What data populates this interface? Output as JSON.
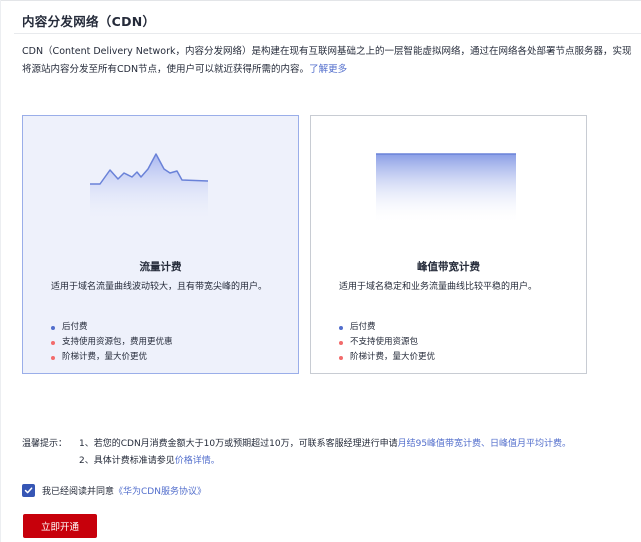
{
  "page": {
    "title": "内容分发网络（CDN）",
    "intro_text": "CDN（Content Delivery Network，内容分发网络）是构建在现有互联网基础之上的一层智能虚拟网络，通过在网络各处部署节点服务器，实现将源站内容分发至所有CDN节点，使用户可以就近获得所需的内容。",
    "intro_link": "了解更多"
  },
  "billing_options": [
    {
      "title": "流量计费",
      "description": "适用于域名流量曲线波动较大，且有带宽尖峰的用户。",
      "features": [
        {
          "text": "后付费",
          "dot": "blue"
        },
        {
          "text": "支持使用资源包，费用更优惠",
          "dot": "red"
        },
        {
          "text": "阶梯计费，量大价更优",
          "dot": "red"
        }
      ],
      "selected": true
    },
    {
      "title": "峰值带宽计费",
      "description": "适用于域名稳定和业务流量曲线比较平稳的用户。",
      "features": [
        {
          "text": "后付费",
          "dot": "blue"
        },
        {
          "text": "不支持使用资源包",
          "dot": "red"
        },
        {
          "text": "阶梯计费，量大价更优",
          "dot": "red"
        }
      ],
      "selected": false
    }
  ],
  "tips": {
    "label": "温馨提示：",
    "line1_prefix": "1、若您的CDN月消费金额大于10万或预期超过10万，可联系客服经理进行申请",
    "line1_link": "月结95峰值带宽计费、日峰值月平均计费。",
    "line2_prefix": "2、具体计费标准请参见",
    "line2_link": "价格详情。"
  },
  "agreement": {
    "checked": true,
    "label_prefix": "我已经阅读并同意",
    "link": "《华为CDN服务协议》"
  },
  "action": {
    "button_label": "立即开通"
  },
  "colors": {
    "accent": "#526ecc",
    "brand_red": "#c7000b",
    "selected_card_bg": "#eef1fb",
    "selected_card_border": "#9aaee9"
  }
}
